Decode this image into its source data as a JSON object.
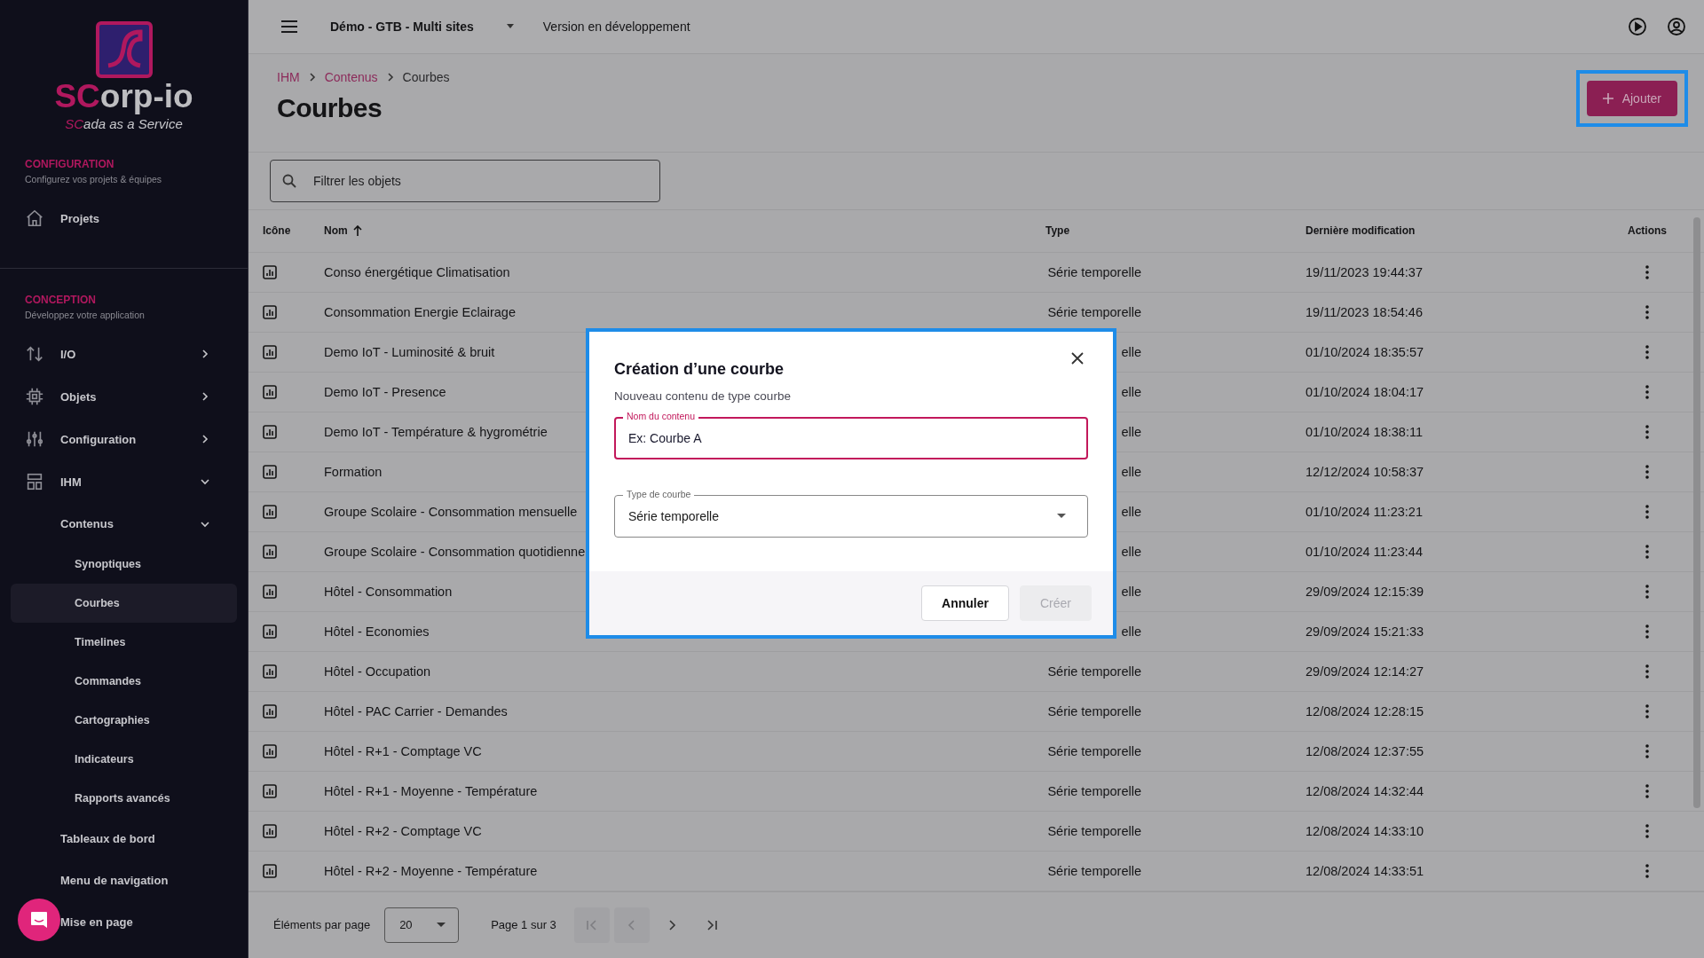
{
  "sidebar": {
    "logo": {
      "name_accent": "SC",
      "name_rest": "orp-io",
      "tagline_accent": "SC",
      "tagline_rest": "ada as a Service"
    },
    "sections": [
      {
        "title": "CONFIGURATION",
        "subtitle": "Configurez vos projets & équipes",
        "items": [
          {
            "label": "Projets",
            "selected": false
          }
        ]
      },
      {
        "title": "CONCEPTION",
        "subtitle": "Développez votre application",
        "items": [
          {
            "label": "I/O",
            "selected": false,
            "expanded": false
          },
          {
            "label": "Objets",
            "selected": false,
            "expanded": false
          },
          {
            "label": "Configuration",
            "selected": false,
            "expanded": false
          },
          {
            "label": "IHM",
            "selected": false,
            "expanded": true,
            "children": [
              {
                "label": "Contenus",
                "selected": false,
                "expanded": true,
                "children": [
                  {
                    "label": "Synoptiques",
                    "selected": false
                  },
                  {
                    "label": "Courbes",
                    "selected": true
                  },
                  {
                    "label": "Timelines",
                    "selected": false
                  },
                  {
                    "label": "Commandes",
                    "selected": false
                  },
                  {
                    "label": "Cartographies",
                    "selected": false
                  },
                  {
                    "label": "Indicateurs",
                    "selected": false
                  },
                  {
                    "label": "Rapports avancés",
                    "selected": false
                  }
                ]
              },
              {
                "label": "Tableaux de bord",
                "selected": false
              },
              {
                "label": "Menu de navigation",
                "selected": false
              },
              {
                "label": "Mise en page",
                "selected": false
              }
            ]
          }
        ]
      }
    ]
  },
  "top_bar": {
    "project": "Démo - GTB - Multi sites",
    "version": "Version en développement"
  },
  "breadcrumb": [
    "IHM",
    "Contenus",
    "Courbes"
  ],
  "page_title": "Courbes",
  "add_button": {
    "label": "Ajouter",
    "focused": true
  },
  "filter": {
    "placeholder": "Filtrer les objets"
  },
  "table": {
    "columns": [
      {
        "label": "Icône"
      },
      {
        "label": "Nom",
        "sorted": true
      },
      {
        "label": "Type"
      },
      {
        "label": "Dernière modification"
      },
      {
        "label": "Actions"
      }
    ],
    "rows": [
      {
        "name": "Conso énergétique Climatisation",
        "type": "Série temporelle",
        "modified": "19/11/2023 19:44:37"
      },
      {
        "name": "Consommation Energie Eclairage",
        "type": "Série temporelle",
        "modified": "19/11/2023 18:54:46"
      },
      {
        "name": "Demo IoT - Luminosité & bruit",
        "type": "elle",
        "modified": "01/10/2024 18:35:57"
      },
      {
        "name": "Demo IoT - Presence",
        "type": "elle",
        "modified": "01/10/2024 18:04:17"
      },
      {
        "name": "Demo IoT - Température & hygrométrie",
        "type": "elle",
        "modified": "01/10/2024 18:38:11"
      },
      {
        "name": "Formation",
        "type": "elle",
        "modified": "12/12/2024 10:58:37"
      },
      {
        "name": "Groupe Scolaire - Consommation mensuelle",
        "type": "elle",
        "modified": "01/10/2024 11:23:21"
      },
      {
        "name": "Groupe Scolaire - Consommation quotidienne",
        "type": "elle",
        "modified": "01/10/2024 11:23:44"
      },
      {
        "name": "Hôtel - Consommation",
        "type": "elle",
        "modified": "29/09/2024 12:15:39"
      },
      {
        "name": "Hôtel - Economies",
        "type": "elle",
        "modified": "29/09/2024 15:21:33"
      },
      {
        "name": "Hôtel - Occupation",
        "type": "Série temporelle",
        "modified": "29/09/2024 12:14:27"
      },
      {
        "name": "Hôtel - PAC Carrier - Demandes",
        "type": "Série temporelle",
        "modified": "12/08/2024 12:28:15"
      },
      {
        "name": "Hôtel - R+1 - Comptage VC",
        "type": "Série temporelle",
        "modified": "12/08/2024 12:37:55"
      },
      {
        "name": "Hôtel - R+1 - Moyenne - Température",
        "type": "Série temporelle",
        "modified": "12/08/2024 14:32:44"
      },
      {
        "name": "Hôtel - R+2 - Comptage VC",
        "type": "Série temporelle",
        "modified": "12/08/2024 14:33:10"
      },
      {
        "name": "Hôtel - R+2 - Moyenne - Température",
        "type": "Série temporelle",
        "modified": "12/08/2024 14:33:51"
      }
    ]
  },
  "pagination": {
    "label": "Éléments par page",
    "page_size": "20",
    "page_info": "Page 1 sur 3",
    "buttons": [
      {
        "kind": "first",
        "disabled": true
      },
      {
        "kind": "prev",
        "disabled": true
      },
      {
        "kind": "next",
        "disabled": false
      },
      {
        "kind": "last",
        "disabled": false
      }
    ]
  },
  "dialog": {
    "title": "Création d’une courbe",
    "subtitle": "Nouveau contenu de type courbe",
    "fields": [
      {
        "kind": "text",
        "label": "Nom du contenu",
        "placeholder": "Ex: Courbe A",
        "focused": true
      },
      {
        "kind": "select",
        "label": "Type de courbe",
        "value": "Série temporelle",
        "focused": false
      }
    ],
    "buttons": [
      {
        "label": "Annuler",
        "disabled": false
      },
      {
        "label": "Créer",
        "disabled": true
      }
    ]
  }
}
